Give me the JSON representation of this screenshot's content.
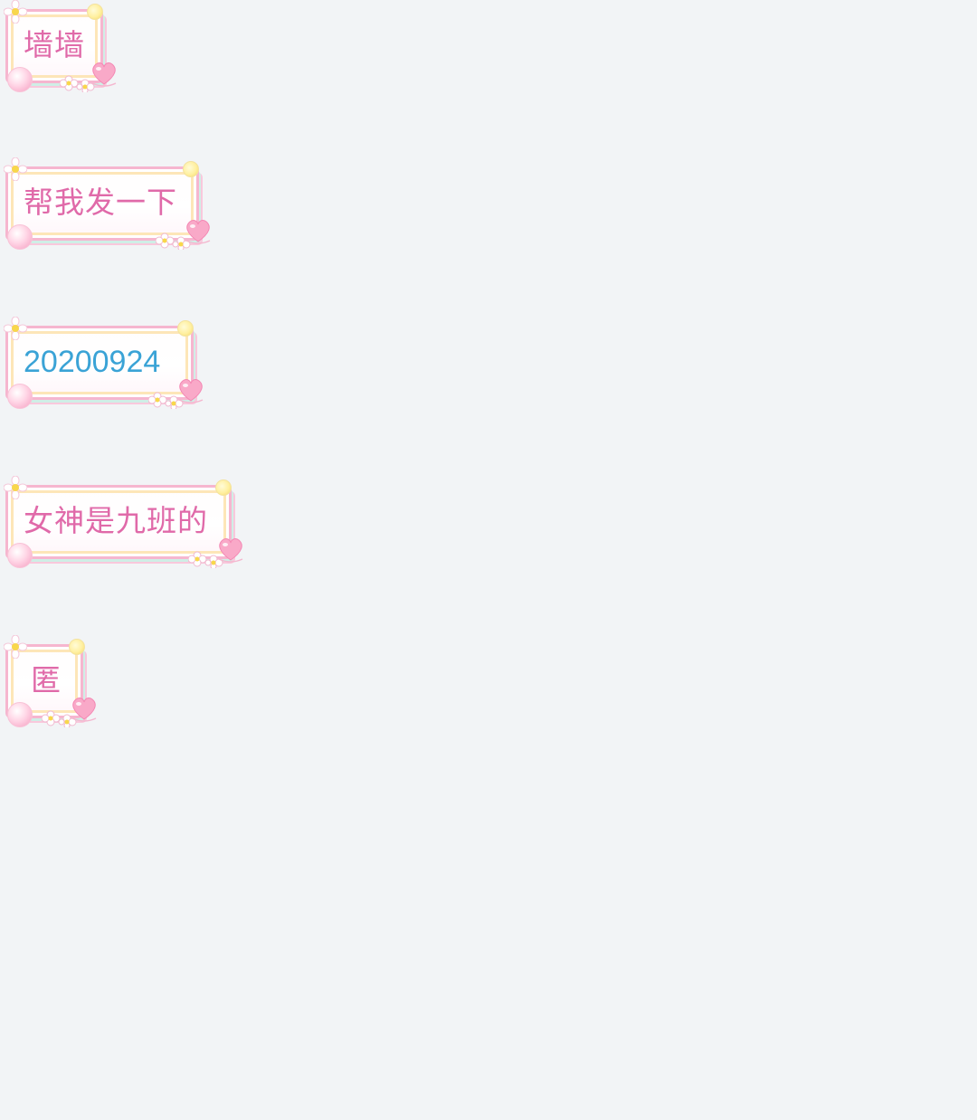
{
  "messages": [
    {
      "text": "墙墙",
      "color": "#e06aa9"
    },
    {
      "text": "帮我发一下",
      "color": "#e06aa9"
    },
    {
      "text": "20200924",
      "color": "#3aa3d6"
    },
    {
      "text": "女神是九班的",
      "color": "#e06aa9"
    },
    {
      "text": "匿",
      "color": "#e06aa9"
    }
  ],
  "icons": {
    "top_left": "flower-icon",
    "top_right": "bead-icon",
    "bottom_left": "pearl-icon",
    "bottom_right": "heart-icon",
    "bottom_flowers": "flower-cluster-icon"
  },
  "colors": {
    "background": "#f2f4f6",
    "bubble_border": "#f6b6cf",
    "accent_yellow": "#fde6b8",
    "accent_mint": "#cfeee6"
  }
}
